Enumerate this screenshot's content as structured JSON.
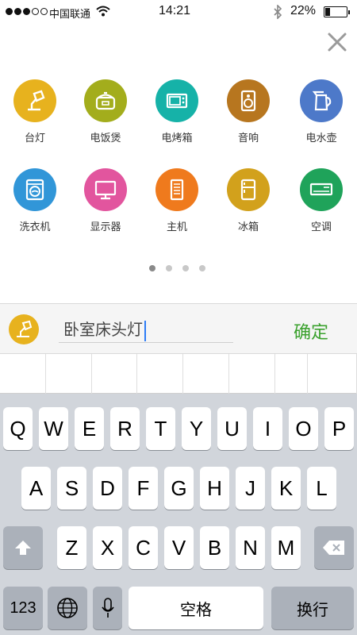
{
  "status_bar": {
    "carrier": "中国联通",
    "time": "14:21",
    "battery_percent": "22%",
    "battery_level": 0.22
  },
  "devices": [
    {
      "label": "台灯",
      "color": "#e7b21e",
      "icon": "desk-lamp-icon"
    },
    {
      "label": "电饭煲",
      "color": "#a3ad1c",
      "icon": "rice-cooker-icon"
    },
    {
      "label": "电烤箱",
      "color": "#16b2a8",
      "icon": "oven-icon"
    },
    {
      "label": "音响",
      "color": "#b7761f",
      "icon": "speaker-icon"
    },
    {
      "label": "电水壶",
      "color": "#4d79c9",
      "icon": "kettle-icon"
    },
    {
      "label": "洗衣机",
      "color": "#3196d8",
      "icon": "washing-machine-icon"
    },
    {
      "label": "显示器",
      "color": "#e2559e",
      "icon": "monitor-icon"
    },
    {
      "label": "主机",
      "color": "#ef7a1d",
      "icon": "pc-tower-icon"
    },
    {
      "label": "冰箱",
      "color": "#d2a11c",
      "icon": "fridge-icon"
    },
    {
      "label": "空调",
      "color": "#1fa35a",
      "icon": "air-conditioner-icon"
    }
  ],
  "pager": {
    "count": 4,
    "active": 0
  },
  "input_bar": {
    "value": "卧室床头灯",
    "confirm_label": "确定",
    "avatar_icon": "desk-lamp-icon"
  },
  "keyboard": {
    "row1": [
      "Q",
      "W",
      "E",
      "R",
      "T",
      "Y",
      "U",
      "I",
      "O",
      "P"
    ],
    "row2": [
      "A",
      "S",
      "D",
      "F",
      "G",
      "H",
      "J",
      "K",
      "L"
    ],
    "row3": [
      "Z",
      "X",
      "C",
      "V",
      "B",
      "N",
      "M"
    ],
    "numbers_label": "123",
    "space_label": "空格",
    "return_label": "换行"
  },
  "colors": {
    "confirm": "#3aa12d",
    "caret": "#2d7cf6"
  }
}
